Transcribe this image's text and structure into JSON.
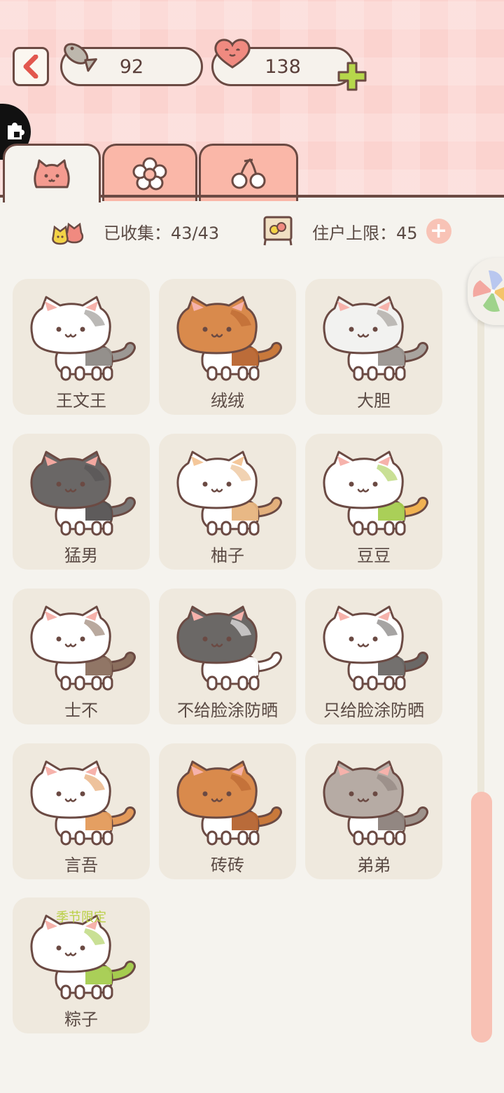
{
  "header": {
    "fish_count": "92",
    "heart_count": "138"
  },
  "tabs": [
    {
      "icon": "cat-face-icon",
      "active": true
    },
    {
      "icon": "flower-icon",
      "active": false
    },
    {
      "icon": "cherry-icon",
      "active": false
    }
  ],
  "stats": {
    "collected_label": "已收集：43/43",
    "capacity_label": "住户上限：45"
  },
  "cats": [
    {
      "name": "王文王",
      "fur": "#ffffff",
      "patch": "#8e8a86",
      "tail": "#9c9894",
      "ear": "#f6b2ab"
    },
    {
      "name": "绒绒",
      "fur": "#d98a4c",
      "patch": "#b8642e",
      "tail": "#c9793b",
      "ear": "#f6b2ab"
    },
    {
      "name": "大胆",
      "fur": "#f2f2f0",
      "patch": "#9a9590",
      "tail": "#a9a49f",
      "ear": "#f6b2ab"
    },
    {
      "name": "猛男",
      "fur": "#6a6766",
      "patch": "#555252",
      "tail": "#7a7776",
      "ear": "#f3a8a0"
    },
    {
      "name": "柚子",
      "fur": "#ffffff",
      "patch": "#e7b47e",
      "tail": "#e3b07c",
      "ear": "#f4c79a"
    },
    {
      "name": "豆豆",
      "fur": "#ffffff",
      "patch": "#a5cc4f",
      "tail": "#f0b252",
      "ear": "#f6b2ab"
    },
    {
      "name": "士不",
      "fur": "#ffffff",
      "patch": "#8b6f5e",
      "tail": "#8b6f5e",
      "ear": "#f6b2ab"
    },
    {
      "name": "不给脸涂防晒",
      "fur": "#6b6866",
      "patch": "#ffffff",
      "tail": "#ffffff",
      "ear": "#f6b2ab"
    },
    {
      "name": "只给脸涂防晒",
      "fur": "#ffffff",
      "patch": "#6b6866",
      "tail": "#6b6866",
      "ear": "#f6b2ab"
    },
    {
      "name": "言吾",
      "fur": "#ffffff",
      "patch": "#e39a5a",
      "tail": "#e39a5a",
      "ear": "#f6b2ab"
    },
    {
      "name": "砖砖",
      "fur": "#d98a4c",
      "patch": "#b5632f",
      "tail": "#c9793b",
      "ear": "#f6b2ab"
    },
    {
      "name": "弟弟",
      "fur": "#b6aba4",
      "patch": "#8c817b",
      "tail": "#9d928b",
      "ear": "#f6b2ab"
    },
    {
      "name": "粽子",
      "fur": "#ffffff",
      "patch": "#a5cc4f",
      "tail": "#a5cc4f",
      "ear": "#f6b2ab",
      "season": "季节限定"
    }
  ]
}
